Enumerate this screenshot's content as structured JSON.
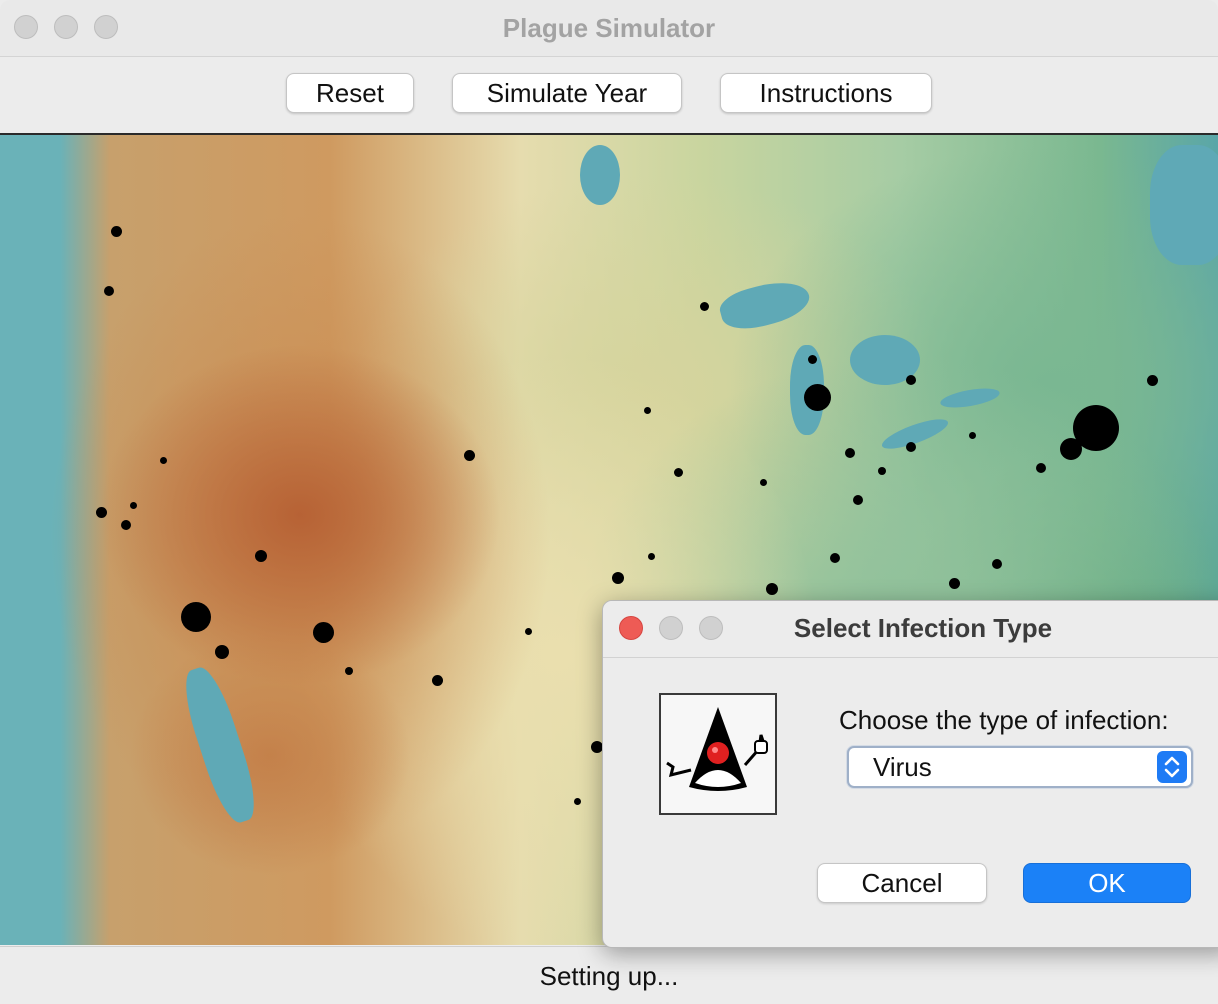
{
  "window": {
    "title": "Plague Simulator"
  },
  "toolbar": {
    "reset_label": "Reset",
    "simulate_label": "Simulate Year",
    "instructions_label": "Instructions"
  },
  "map": {
    "description_icon": "relief-map-north-america"
  },
  "status": {
    "text": "Setting up..."
  },
  "dialog": {
    "title": "Select Infection Type",
    "prompt": "Choose the type of infection:",
    "selected_type": "Virus",
    "cancel_label": "Cancel",
    "ok_label": "OK",
    "icon": "java-duke-icon",
    "accent_color": "#1b81f7"
  }
}
